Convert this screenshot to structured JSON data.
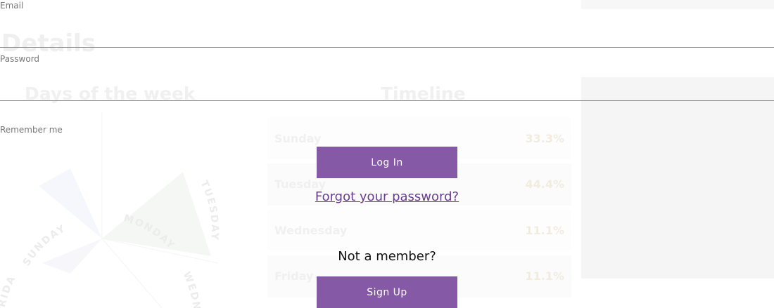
{
  "background": {
    "heading": "Details",
    "days_heading": "Days of the week",
    "timeline_heading": "Timeline",
    "wheel_labels": [
      "SUNDAY",
      "MONDAY",
      "TUESDAY",
      "WEDNESDAY",
      "FRIDAY"
    ],
    "timeline_rows": [
      {
        "day": "Sunday",
        "percent": "33.3%"
      },
      {
        "day": "Tuesday",
        "percent": "44.4%"
      },
      {
        "day": "Wednesday",
        "percent": "11.1%"
      },
      {
        "day": "Friday",
        "percent": "11.1%"
      }
    ]
  },
  "login": {
    "email_label": "Email",
    "email_value": "",
    "password_label": "Password",
    "password_value": "",
    "remember_label": "Remember me",
    "login_button": "Log In",
    "forgot_link": "Forgot your password?",
    "not_member_text": "Not a member?",
    "signup_button": "Sign Up"
  },
  "colors": {
    "accent": "#8559a5",
    "link": "#6a3c8f"
  }
}
